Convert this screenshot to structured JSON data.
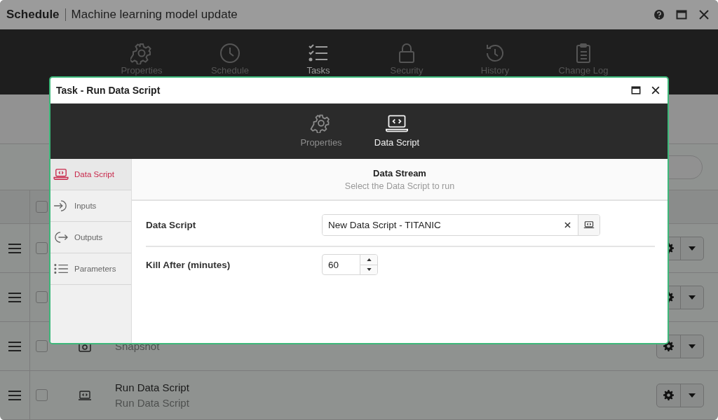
{
  "window": {
    "title": "Schedule",
    "subtitle": "Machine learning model update"
  },
  "nav_tabs": [
    {
      "label": "Properties",
      "selected": false
    },
    {
      "label": "Schedule",
      "selected": false
    },
    {
      "label": "Tasks",
      "selected": true
    },
    {
      "label": "Security",
      "selected": false
    },
    {
      "label": "History",
      "selected": false
    },
    {
      "label": "Change Log",
      "selected": false
    }
  ],
  "header_checkbox": {
    "checked": false
  },
  "task_rows": [
    {
      "checked": false
    },
    {
      "checked": false
    },
    {
      "checked": false,
      "subtitle": "Snapshot"
    },
    {
      "checked": false,
      "title": "Run Data Script",
      "subtitle": "Run Data Script"
    }
  ],
  "dialog": {
    "title": "Task - Run Data Script",
    "tabs": [
      {
        "label": "Properties",
        "selected": false
      },
      {
        "label": "Data Script",
        "selected": true
      }
    ],
    "sidebar": [
      {
        "label": "Data Script",
        "selected": true
      },
      {
        "label": "Inputs",
        "selected": false
      },
      {
        "label": "Outputs",
        "selected": false
      },
      {
        "label": "Parameters",
        "selected": false
      }
    ],
    "section": {
      "title": "Data Stream",
      "subtitle": "Select the Data Script to run"
    },
    "fields": [
      {
        "kind": "picker",
        "label": "Data Script",
        "value": "New Data Script - TITANIC"
      },
      {
        "kind": "spinner",
        "label": "Kill After (minutes)",
        "value": "60"
      }
    ]
  }
}
